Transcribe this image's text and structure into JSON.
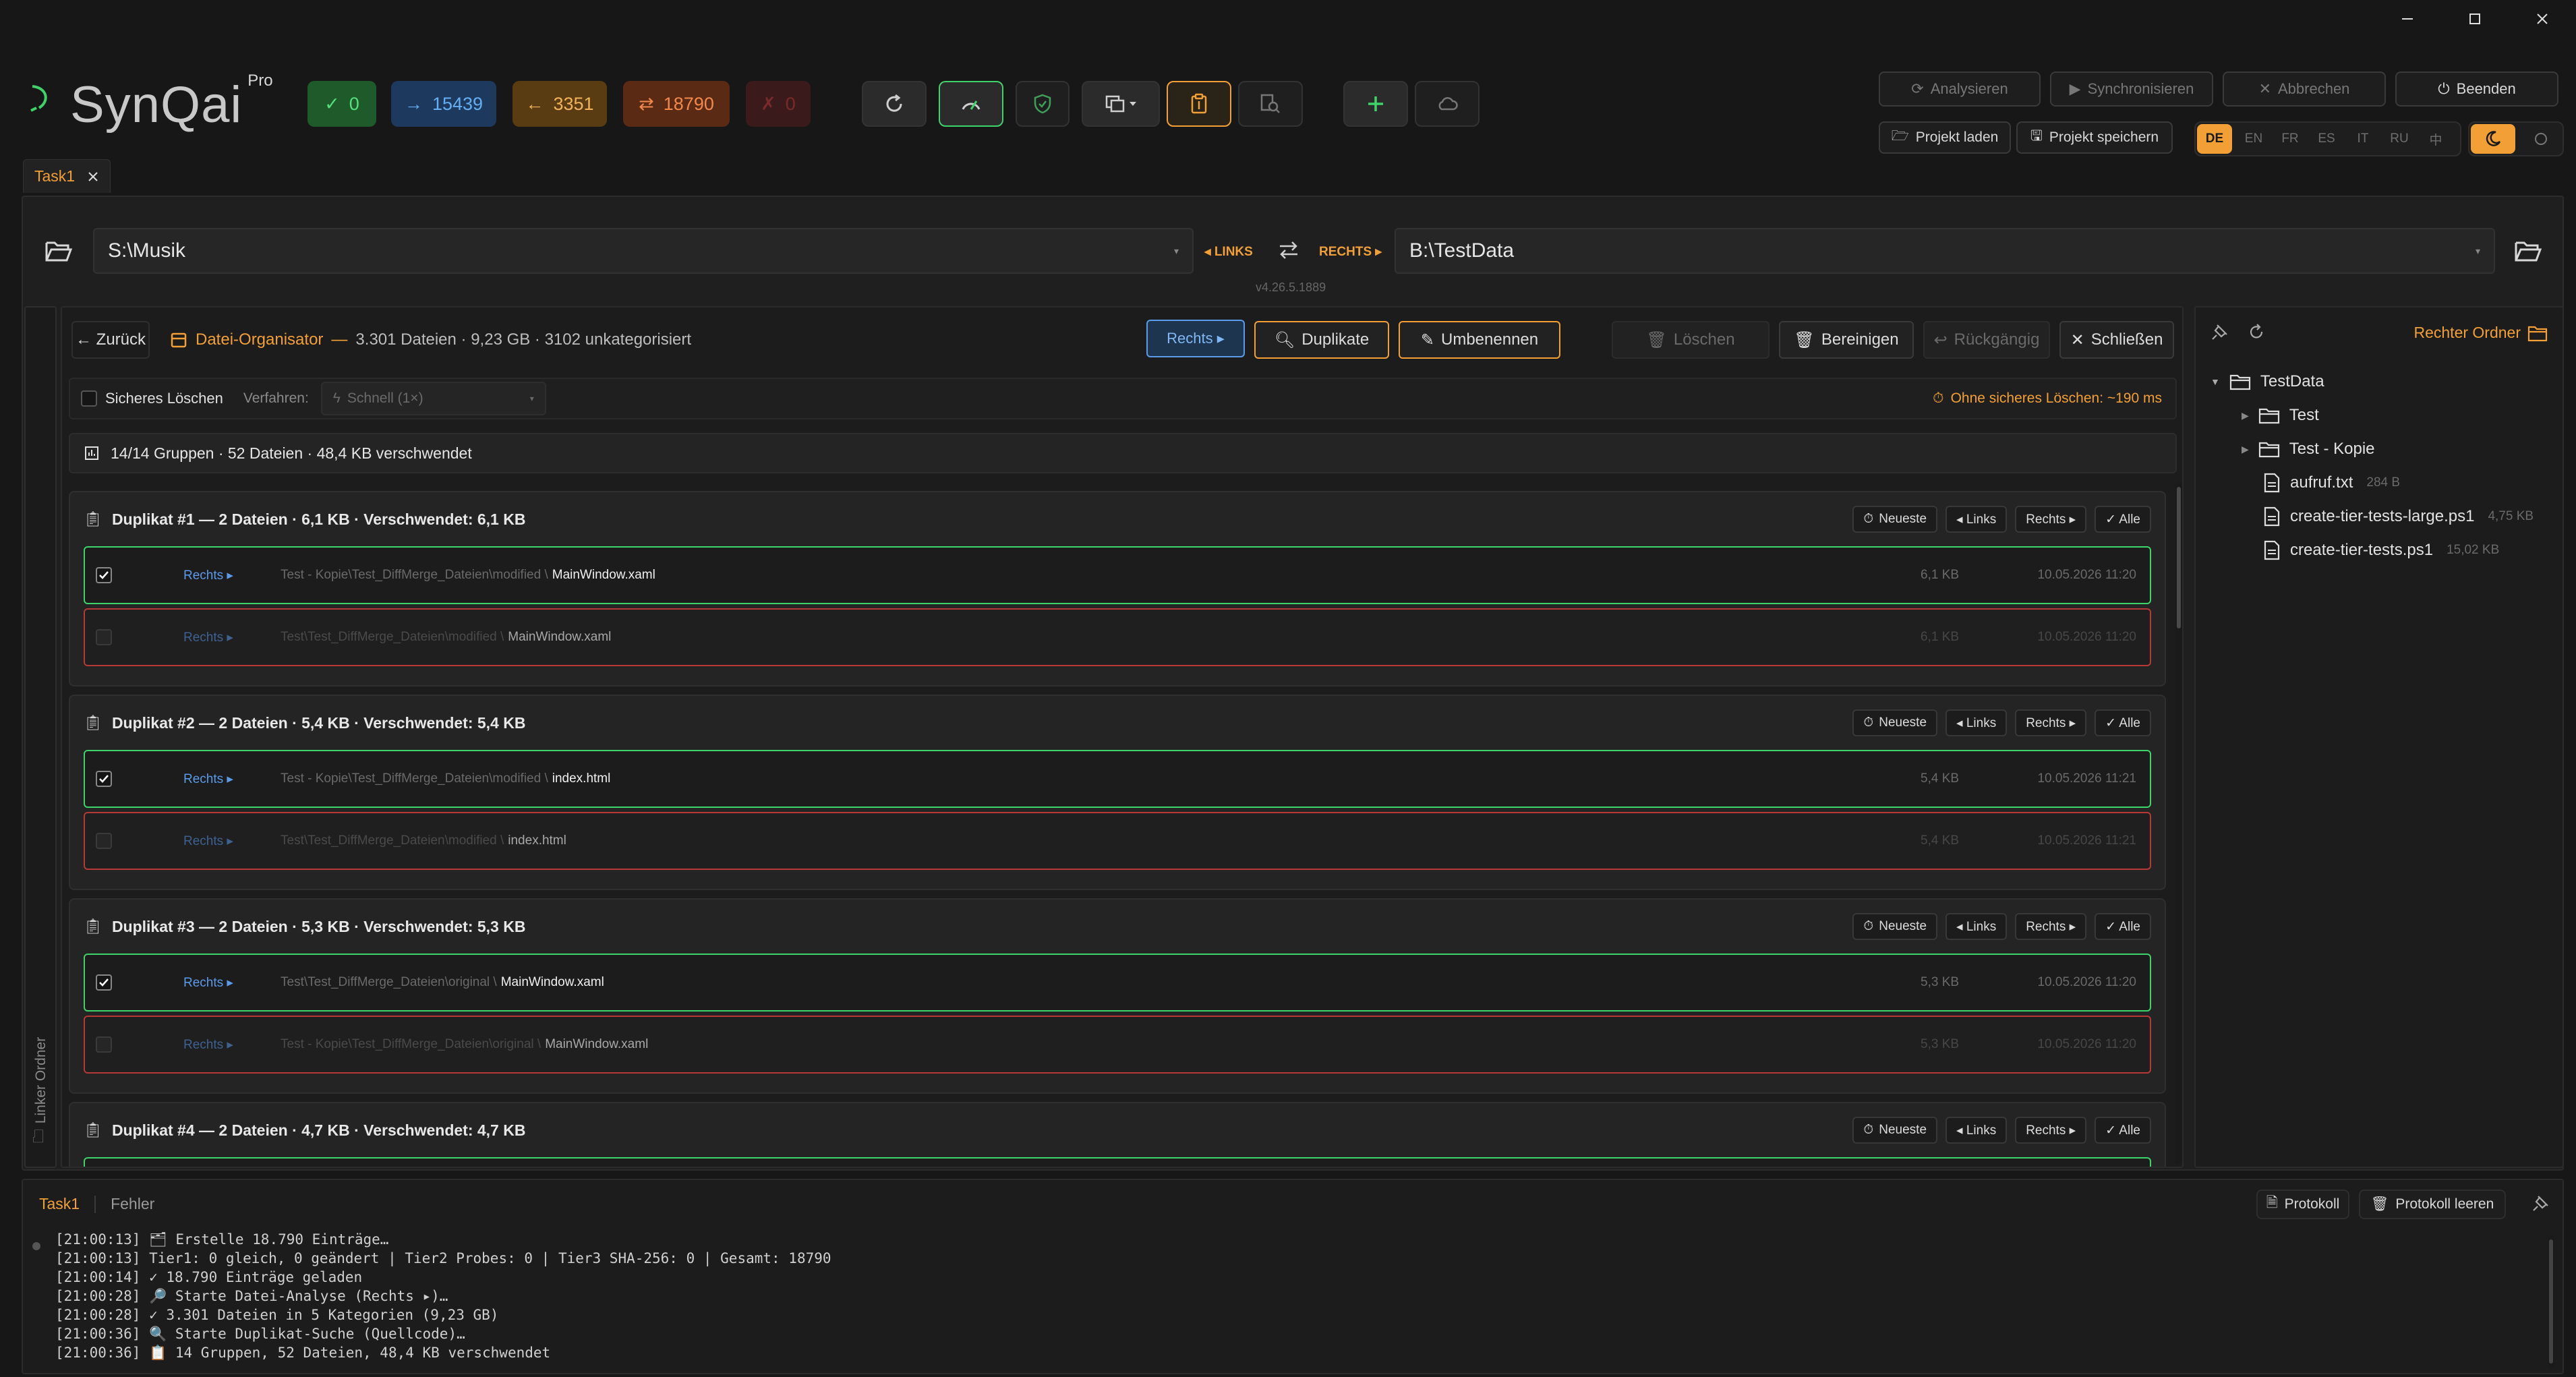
{
  "app": {
    "name": "SynQai",
    "edition": "Pro",
    "version": "v4.26.5.1889"
  },
  "stats": [
    {
      "icon": "check-icon",
      "value": "0",
      "bg": "#1f5a2b",
      "color": "#54e07c"
    },
    {
      "icon": "arrow-right-icon",
      "value": "15439",
      "bg": "#1d3a5e",
      "color": "#66aef2"
    },
    {
      "icon": "arrow-left-icon",
      "value": "3351",
      "bg": "#5a3c12",
      "color": "#f2b25a"
    },
    {
      "icon": "swap-icon",
      "value": "18790",
      "bg": "#5a2a14",
      "color": "#f2894a"
    },
    {
      "icon": "x-icon",
      "value": "0",
      "bg": "#3a1a1a",
      "color": "#7a2a2a"
    }
  ],
  "actions": {
    "analyze": "Analysieren",
    "sync": "Synchronisieren",
    "cancel": "Abbrechen",
    "quit": "Beenden",
    "load_project": "Projekt laden",
    "save_project": "Projekt speichern"
  },
  "languages": [
    "DE",
    "EN",
    "FR",
    "ES",
    "IT",
    "RU",
    "中"
  ],
  "active_language": "DE",
  "tabs": [
    {
      "label": "Task1"
    }
  ],
  "paths": {
    "left": "S:\\Musik",
    "left_label": "◂ LINKS",
    "right_label": "RECHTS ▸",
    "right": "B:\\TestData"
  },
  "organizer": {
    "back": "← Zurück",
    "title": "Datei-Organisator",
    "dash": "—",
    "summary": "3.301 Dateien · 9,23 GB · 3102 unkategorisiert",
    "side_button": "Rechts ▸",
    "duplicates": "Duplikate",
    "rename": "Umbenennen",
    "delete": "Löschen",
    "cleanup": "Bereinigen",
    "undo": "Rückgängig",
    "close": "Schließen",
    "secure_delete": "Sicheres Löschen",
    "method_label": "Verfahren:",
    "method_value": "Schnell (1×)",
    "eta": "Ohne sicheres Löschen: ~190 ms",
    "groups_summary": "14/14 Gruppen · 52 Dateien · 48,4 KB verschwendet"
  },
  "group_buttons": {
    "newest": "Neueste",
    "left": "◂ Links",
    "right": "Rechts ▸",
    "all": "✓ Alle"
  },
  "groups": [
    {
      "title": "Duplikat #1 — 2 Dateien · 6,1 KB · Verschwendet: 6,1 KB",
      "rows": [
        {
          "side": "Rechts ▸",
          "path": "Test - Kopie\\Test_DiffMerge_Dateien\\modified \\",
          "name": "MainWindow.xaml",
          "size": "6,1 KB",
          "date": "10.05.2026 11:20",
          "checked": true
        },
        {
          "side": "Rechts ▸",
          "path": "Test\\Test_DiffMerge_Dateien\\modified \\",
          "name": "MainWindow.xaml",
          "size": "6,1 KB",
          "date": "10.05.2026 11:20",
          "checked": false
        }
      ]
    },
    {
      "title": "Duplikat #2 — 2 Dateien · 5,4 KB · Verschwendet: 5,4 KB",
      "rows": [
        {
          "side": "Rechts ▸",
          "path": "Test - Kopie\\Test_DiffMerge_Dateien\\modified \\",
          "name": "index.html",
          "size": "5,4 KB",
          "date": "10.05.2026 11:21",
          "checked": true
        },
        {
          "side": "Rechts ▸",
          "path": "Test\\Test_DiffMerge_Dateien\\modified \\",
          "name": "index.html",
          "size": "5,4 KB",
          "date": "10.05.2026 11:21",
          "checked": false
        }
      ]
    },
    {
      "title": "Duplikat #3 — 2 Dateien · 5,3 KB · Verschwendet: 5,3 KB",
      "rows": [
        {
          "side": "Rechts ▸",
          "path": "Test\\Test_DiffMerge_Dateien\\original \\",
          "name": "MainWindow.xaml",
          "size": "5,3 KB",
          "date": "10.05.2026 11:20",
          "checked": true
        },
        {
          "side": "Rechts ▸",
          "path": "Test - Kopie\\Test_DiffMerge_Dateien\\original \\",
          "name": "MainWindow.xaml",
          "size": "5,3 KB",
          "date": "10.05.2026 11:20",
          "checked": false
        }
      ]
    },
    {
      "title": "Duplikat #4 — 2 Dateien · 4,7 KB · Verschwendet: 4,7 KB",
      "rows": []
    }
  ],
  "left_strip_label": "Linker Ordner",
  "right_panel": {
    "title": "Rechter Ordner",
    "root": "TestData",
    "items": [
      {
        "label": "Test",
        "type": "folder",
        "size": ""
      },
      {
        "label": "Test - Kopie",
        "type": "folder",
        "size": ""
      },
      {
        "label": "aufruf.txt",
        "type": "file",
        "size": "284 B"
      },
      {
        "label": "create-tier-tests-large.ps1",
        "type": "file",
        "size": "4,75 KB"
      },
      {
        "label": "create-tier-tests.ps1",
        "type": "file",
        "size": "15,02 KB"
      }
    ]
  },
  "log": {
    "tabs": [
      "Task1",
      "Fehler"
    ],
    "protocol": "Protokoll",
    "clear": "Protokoll leeren",
    "lines": [
      "[21:00:13] 🗂 Erstelle 18.790 Einträge…",
      "[21:00:13] Tier1: 0 gleich, 0 geändert | Tier2 Probes: 0 | Tier3 SHA-256: 0 | Gesamt: 18790",
      "[21:00:14] ✓ 18.790 Einträge geladen",
      "[21:00:28] 🔎 Starte Datei-Analyse (Rechts ▸)…",
      "[21:00:28] ✓ 3.301 Dateien in 5 Kategorien (9,23 GB)",
      "[21:00:36] 🔍 Starte Duplikat-Suche (Quellcode)…",
      "[21:00:36] 📋 14 Gruppen, 52 Dateien, 48,4 KB verschwendet"
    ]
  }
}
